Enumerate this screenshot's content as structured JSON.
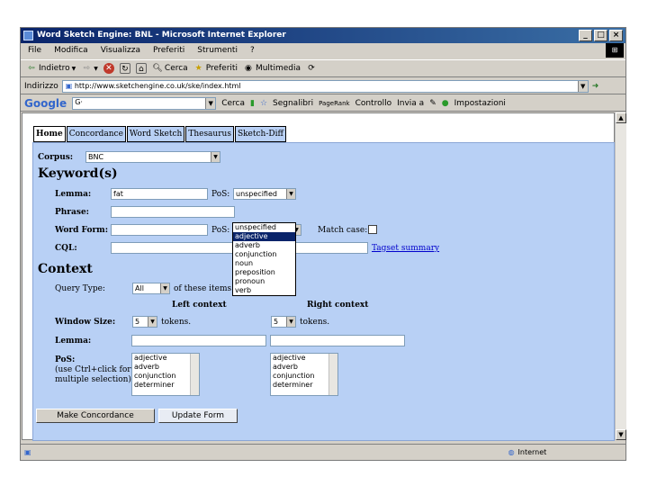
{
  "window": {
    "title": "Word Sketch Engine: BNL - Microsoft Internet Explorer"
  },
  "menubar": [
    "File",
    "Modifica",
    "Visualizza",
    "Preferiti",
    "Strumenti",
    "?"
  ],
  "toolbar": {
    "back": "Indietro",
    "search": "Cerca",
    "favorites": "Preferiti",
    "multimedia": "Multimedia"
  },
  "address": {
    "label": "Indirizzo",
    "url": "http://www.sketchengine.co.uk/ske/index.html"
  },
  "google_bar": {
    "logo": "Google",
    "search_value": "G·",
    "search_button": "Cerca",
    "bookmarks": "Segnalibri",
    "pagerank": "PageRank",
    "spellcheck": "Controllo",
    "send": "Invia a",
    "settings": "Impostazioni"
  },
  "tabs": [
    "Home",
    "Concordance",
    "Word Sketch",
    "Thesaurus",
    "Sketch-Diff"
  ],
  "corpus": {
    "label": "Corpus:",
    "value": "BNC"
  },
  "keywords": {
    "heading": "Keyword(s)",
    "lemma_label": "Lemma:",
    "lemma_value": "fat",
    "pos_label": "PoS:",
    "pos_value": "unspecified",
    "phrase_label": "Phrase:",
    "wordform_label": "Word Form:",
    "pos2_label": "PoS:",
    "match_case_label": "Match case:",
    "cql_label": "CQL:",
    "tagset_link": "Tagset summary"
  },
  "pos_dropdown": [
    "unspecified",
    "adjective",
    "adverb",
    "conjunction",
    "noun",
    "preposition",
    "pronoun",
    "verb"
  ],
  "pos_dropdown_highlighted": "adjective",
  "context": {
    "heading": "Context",
    "query_type_label": "Query Type:",
    "query_type_value": "All",
    "query_type_suffix": "of these items",
    "left_heading": "Left context",
    "right_heading": "Right context",
    "window_size_label": "Window Size:",
    "left_window": "5",
    "right_window": "5",
    "tokens_left": "tokens.",
    "tokens_right": "tokens.",
    "lemma_label": "Lemma:",
    "pos_label": "PoS:",
    "pos_hint_1": "(use Ctrl+click for",
    "pos_hint_2": "multiple selection)",
    "left_pos_options": [
      "adjective",
      "adverb",
      "conjunction",
      "determiner"
    ],
    "right_pos_options": [
      "adjective",
      "adverb",
      "conjunction",
      "determiner"
    ]
  },
  "buttons": {
    "make_concordance": "Make Concordance",
    "update_form": "Update Form"
  },
  "status": {
    "zone": "Internet"
  }
}
